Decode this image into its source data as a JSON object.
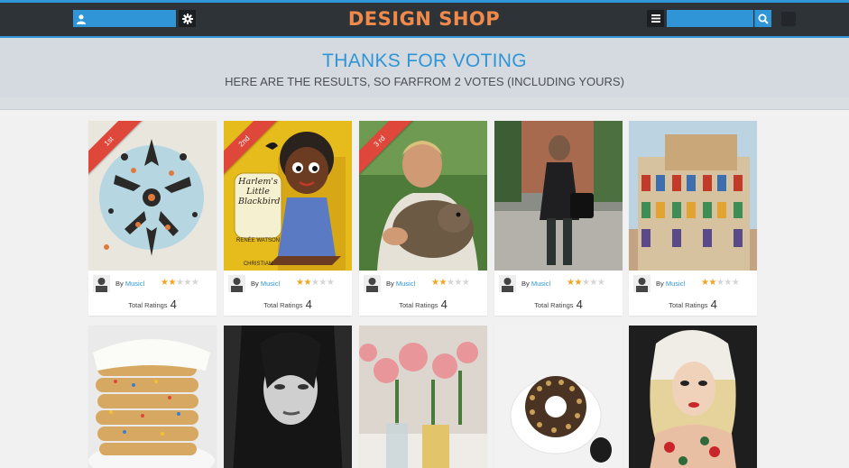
{
  "header": {
    "brand": "DESIGN SHOP",
    "user_field_value": "",
    "search_field_value": "",
    "accent_color": "#2f95d6",
    "brand_color": "#f08a4b"
  },
  "banner": {
    "title": "THANKS FOR VOTING",
    "subtitle": "HERE ARE THE RESULTS, SO FARFROM 2 VOTES (INCLUDING YOURS)"
  },
  "cards": [
    {
      "ribbon": "1st",
      "by": "By",
      "author": "Musicl",
      "rating_stars": 2,
      "max_stars": 5,
      "total_label": "Total Ratings",
      "total": "4"
    },
    {
      "ribbon": "2nd",
      "by": "By",
      "author": "Musicl",
      "rating_stars": 2,
      "max_stars": 5,
      "total_label": "Total Ratings",
      "total": "4",
      "book_title_lines": [
        "Harlem's",
        "Little",
        "Blackbird"
      ],
      "book_author": "RENÉE WATSON",
      "book_illustrator": "CHRISTIAN"
    },
    {
      "ribbon": "3 rd",
      "by": "By",
      "author": "Musicl",
      "rating_stars": 2,
      "max_stars": 5,
      "total_label": "Total Ratings",
      "total": "4"
    },
    {
      "by": "By",
      "author": "Musicl",
      "rating_stars": 2,
      "max_stars": 5,
      "total_label": "Total Ratings",
      "total": "4"
    },
    {
      "by": "By",
      "author": "Musicl",
      "rating_stars": 2,
      "max_stars": 5,
      "total_label": "Total Ratings",
      "total": "4"
    },
    {},
    {},
    {},
    {},
    {}
  ]
}
